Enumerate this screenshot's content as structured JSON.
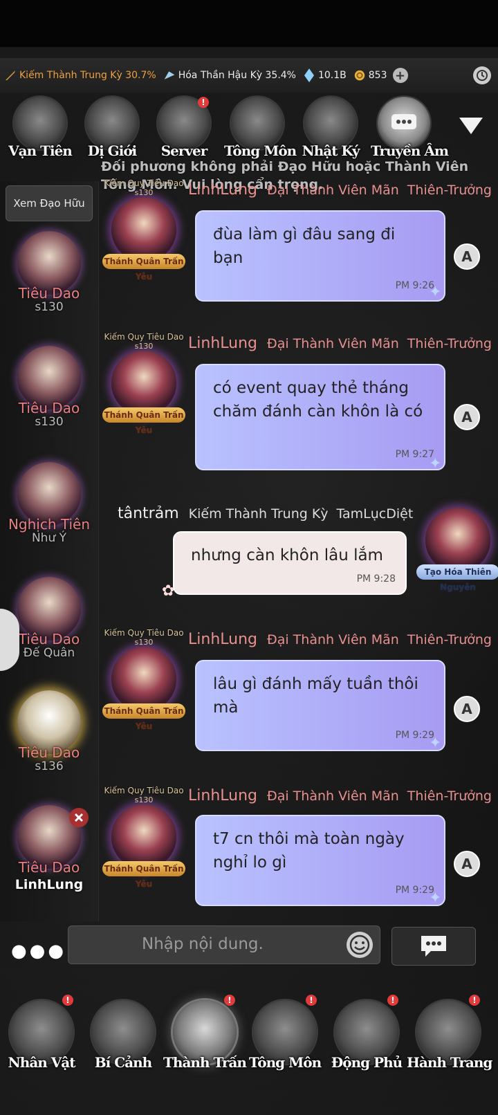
{
  "status": {
    "cultivation_1": "Kiếm Thành Trung Kỳ 30.7%",
    "cultivation_2": "Hóa Thần Hậu Kỳ 35.4%",
    "crystal": "10.1B",
    "coin": "853"
  },
  "top_tabs": [
    "Vạn Tiên",
    "Dị Giới",
    "Server",
    "Tông Môn",
    "Nhật Ký",
    "Truyền Âm"
  ],
  "notice": "Đối phương không phải Đạo Hữu hoặc Thành Viên Tông Môn. Vui lòng cẩn trọng.",
  "sidebar": {
    "view_friends": "Xem Đạo Hữu",
    "contacts": [
      {
        "rank": "Tiêu Dao",
        "sub": "s130"
      },
      {
        "rank": "Tiêu Dao",
        "sub": "s130"
      },
      {
        "rank": "Nghịch Tiên",
        "sub": "Như Ý"
      },
      {
        "rank": "Tiêu Dao",
        "sub": "Đế Quân"
      },
      {
        "rank": "Tiêu Dao",
        "sub": "s136"
      },
      {
        "rank": "Tiêu Dao",
        "sub": "",
        "name": "LinhLung"
      }
    ]
  },
  "messages": [
    {
      "title": "Kiếm Quy Tiêu Dao",
      "lvl": "s130",
      "banner": "Thánh Quân Trấn Yêu",
      "name": "LinhLung",
      "level": "Đại Thành Viên Mãn",
      "guild": "Thiên-Trưởng",
      "text": "đùa làm gì đâu sang đi bạn",
      "time": "PM 9:26"
    },
    {
      "title": "Kiếm Quy Tiêu Dao",
      "lvl": "s130",
      "banner": "Thánh Quân Trấn Yêu",
      "name": "LinhLung",
      "level": "Đại Thành Viên Mãn",
      "guild": "Thiên-Trưởng",
      "text": "có event quay thẻ tháng chăm đánh càn khôn là có",
      "time": "PM 9:27"
    },
    {
      "banner": "Tạo Hóa Thiên Nguyên",
      "name": "tântrảm",
      "level": "Kiếm Thành Trung Kỳ",
      "guild": "TamLụcDiệt",
      "text": "nhưng càn khôn lâu lắm",
      "time": "PM 9:28"
    },
    {
      "title": "Kiếm Quy Tiêu Dao",
      "lvl": "s130",
      "banner": "Thánh Quân Trấn Yêu",
      "name": "LinhLung",
      "level": "Đại Thành Viên Mãn",
      "guild": "Thiên-Trưởng",
      "text": "lâu gì đánh mấy tuần thôi mà",
      "time": "PM 9:29"
    },
    {
      "title": "Kiếm Quy Tiêu Dao",
      "lvl": "s130",
      "banner": "Thánh Quân Trấn Yêu",
      "name": "LinhLung",
      "level": "Đại Thành Viên Mãn",
      "guild": "Thiên-Trưởng",
      "text": "t7 cn thôi mà toàn ngày nghỉ lo gì",
      "time": "PM 9:29"
    }
  ],
  "input": {
    "placeholder": "Nhập nội dung."
  },
  "bottom_nav": [
    "Nhân Vật",
    "Bí Cảnh",
    "Thành Trấn",
    "Tông Môn",
    "Động Phủ",
    "Hành Trang"
  ],
  "colors": {
    "bubble_other": "#b0b0f5",
    "bubble_mine": "#f3e8e8",
    "name_color": "#e89090",
    "badge": "#e23b3b"
  }
}
